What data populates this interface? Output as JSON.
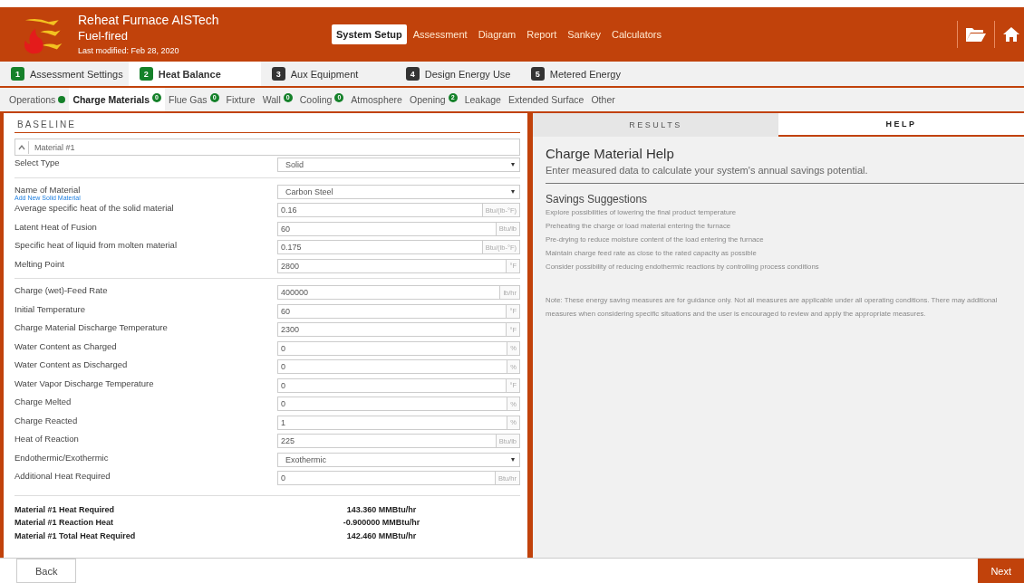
{
  "header": {
    "title": "Reheat Furnace AISTech",
    "subtitle": "Fuel-fired",
    "modified": "Last modified: Feb 28, 2020",
    "nav": [
      {
        "label": "System Setup",
        "selected": true
      },
      {
        "label": "Assessment",
        "selected": false
      },
      {
        "label": "Diagram",
        "selected": false
      },
      {
        "label": "Report",
        "selected": false
      },
      {
        "label": "Sankey",
        "selected": false
      },
      {
        "label": "Calculators",
        "selected": false
      }
    ]
  },
  "steps": [
    {
      "number": "1",
      "label": "Assessment Settings",
      "selected": false,
      "complete": true
    },
    {
      "number": "2",
      "label": "Heat Balance",
      "selected": true,
      "complete": true
    },
    {
      "number": "3",
      "label": "Aux Equipment",
      "selected": false,
      "complete": false
    },
    {
      "number": "4",
      "label": "Design Energy Use",
      "selected": false,
      "complete": false
    },
    {
      "number": "5",
      "label": "Metered Energy",
      "selected": false,
      "complete": false
    }
  ],
  "subtabs": [
    {
      "label": "Operations",
      "selected": false,
      "kind": "dot"
    },
    {
      "label": "Charge Materials",
      "selected": true,
      "kind": "count",
      "badge": "0"
    },
    {
      "label": "Flue Gas",
      "selected": false,
      "kind": "count",
      "badge": "0"
    },
    {
      "label": "Fixture",
      "selected": false,
      "kind": "none"
    },
    {
      "label": "Wall",
      "selected": false,
      "kind": "count",
      "badge": "0"
    },
    {
      "label": "Cooling",
      "selected": false,
      "kind": "count",
      "badge": "0"
    },
    {
      "label": "Atmosphere",
      "selected": false,
      "kind": "none"
    },
    {
      "label": "Opening",
      "selected": false,
      "kind": "count",
      "badge": "2"
    },
    {
      "label": "Leakage",
      "selected": false,
      "kind": "none"
    },
    {
      "label": "Extended Surface",
      "selected": false,
      "kind": "none"
    },
    {
      "label": "Other",
      "selected": false,
      "kind": "none"
    }
  ],
  "baseline": {
    "heading": "BASELINE",
    "material": "Material #1",
    "groups": [
      [
        {
          "kind": "select",
          "label": "Select Type",
          "value": "Solid"
        }
      ],
      [
        {
          "kind": "select",
          "label": "Name of Material",
          "value": "Carbon Steel",
          "link": "Add New Solid Material"
        },
        {
          "kind": "input",
          "label": "Average specific heat of the solid material",
          "value": "0.16",
          "unit": "Btu/(lb-°F)"
        },
        {
          "kind": "input",
          "label": "Latent Heat of Fusion",
          "value": "60",
          "unit": "Btu/lb"
        },
        {
          "kind": "input",
          "label": "Specific heat of liquid from molten material",
          "value": "0.175",
          "unit": "Btu/(lb-°F)"
        },
        {
          "kind": "input",
          "label": "Melting Point",
          "value": "2800",
          "unit": "°F"
        }
      ],
      [
        {
          "kind": "input",
          "label": "Charge (wet)-Feed Rate",
          "value": "400000",
          "unit": "lb/hr"
        },
        {
          "kind": "input",
          "label": "Initial Temperature",
          "value": "60",
          "unit": "°F"
        },
        {
          "kind": "input",
          "label": "Charge Material Discharge Temperature",
          "value": "2300",
          "unit": "°F"
        },
        {
          "kind": "input",
          "label": "Water Content as Charged",
          "value": "0",
          "unit": "%"
        },
        {
          "kind": "input",
          "label": "Water Content as Discharged",
          "value": "0",
          "unit": "%"
        },
        {
          "kind": "input",
          "label": "Water Vapor Discharge Temperature",
          "value": "0",
          "unit": "°F"
        },
        {
          "kind": "input",
          "label": "Charge Melted",
          "value": "0",
          "unit": "%"
        },
        {
          "kind": "input",
          "label": "Charge Reacted",
          "value": "1",
          "unit": "%"
        },
        {
          "kind": "input",
          "label": "Heat of Reaction",
          "value": "225",
          "unit": "Btu/lb"
        },
        {
          "kind": "select",
          "label": "Endothermic/Exothermic",
          "value": "Exothermic"
        },
        {
          "kind": "input",
          "label": "Additional Heat Required",
          "value": "0",
          "unit": "Btu/hr"
        }
      ]
    ],
    "totals": [
      {
        "label": "Material #1 Heat Required",
        "value": "143.360 MMBtu/hr"
      },
      {
        "label": "Material #1 Reaction Heat",
        "value": "-0.900000 MMBtu/hr"
      },
      {
        "label": "Material #1 Total Heat Required",
        "value": "142.460 MMBtu/hr"
      }
    ]
  },
  "panel_tabs": [
    {
      "label": "RESULTS",
      "selected": false
    },
    {
      "label": "HELP",
      "selected": true
    }
  ],
  "help": {
    "title": "Charge Material Help",
    "intro": "Enter measured data to calculate your system's annual savings potential.",
    "suggestions_title": "Savings Suggestions",
    "suggestions": [
      "Explore possibilities of lowering the final product temperature",
      "Preheating the charge or load material entering the furnace",
      "Pre-drying to reduce moisture content of the load entering the furnace",
      "Maintain charge feed rate as close to the rated capacity as possible",
      "Consider possibility of reducing endothermic reactions by controlling process conditions"
    ],
    "note": "Note: These energy saving measures are for guidance only. Not all measures are applicable under all operating conditions. There may additional measures when considering specific situations and the user is encouraged to review and apply the appropriate measures."
  },
  "footer": {
    "back": "Back",
    "next": "Next"
  }
}
